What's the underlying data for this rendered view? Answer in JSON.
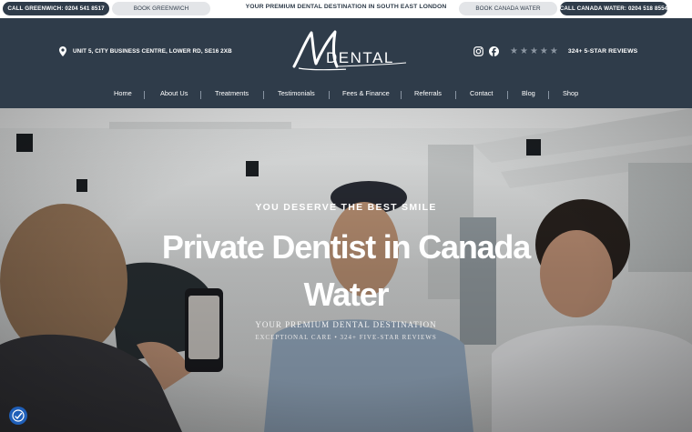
{
  "topbar": {
    "call_greenwich": "CALL GREENWICH: 0204 541 8517",
    "book_greenwich": "BOOK GREENWICH",
    "tagline": "YOUR PREMIUM DENTAL DESTINATION IN SOUTH EAST LONDON",
    "book_canada": "BOOK CANADA WATER",
    "call_canada": "CALL CANADA WATER: 0204 518 8554"
  },
  "header": {
    "address": "UNIT 5, CITY BUSINESS CENTRE, LOWER RD, SE16 2XB",
    "logo_text": "DENTAL",
    "reviews": "324+ 5-STAR REVIEWS",
    "star_color": "#8b95a1"
  },
  "nav": {
    "items": [
      "Home",
      "About Us",
      "Treatments",
      "Testimonials",
      "Fees & Finance",
      "Referrals",
      "Contact",
      "Blog",
      "Shop"
    ]
  },
  "hero": {
    "eyebrow": "YOU DESERVE THE BEST SMILE",
    "headline": "Private Dentist in Canada Water",
    "sub1": "YOUR PREMIUM DENTAL DESTINATION",
    "sub2": "EXCEPTIONAL CARE • 324+ FIVE-STAR REVIEWS"
  },
  "colors": {
    "brand_dark": "#2f3c4a",
    "accessibility_blue": "#1f5fb8"
  }
}
